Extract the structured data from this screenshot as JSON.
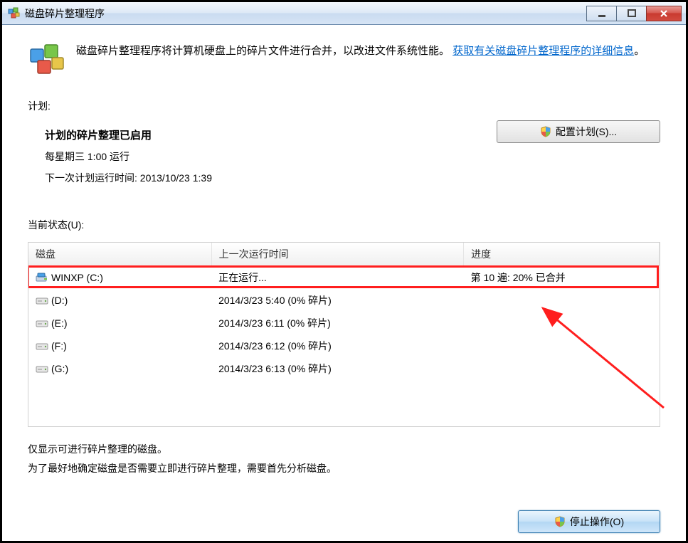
{
  "window": {
    "title": "磁盘碎片整理程序"
  },
  "intro": {
    "text_before_link": "磁盘碎片整理程序将计算机硬盘上的碎片文件进行合并，以改进文件系统性能。",
    "link_text": "获取有关磁盘碎片整理程序的详细信息",
    "period": "。"
  },
  "schedule": {
    "label": "计划:",
    "title": "计划的碎片整理已启用",
    "when": "每星期三   1:00 运行",
    "next": "下一次计划运行时间: 2013/10/23 1:39",
    "config_button": "配置计划(S)..."
  },
  "status": {
    "label": "当前状态(U):"
  },
  "table": {
    "col_disk": "磁盘",
    "col_last": "上一次运行时间",
    "col_progress": "进度",
    "rows": [
      {
        "icon": "os",
        "name": "WINXP (C:)",
        "last": "正在运行...",
        "progress": "第 10 遍: 20% 已合并"
      },
      {
        "icon": "hdd",
        "name": "(D:)",
        "last": "2014/3/23 5:40 (0% 碎片)",
        "progress": ""
      },
      {
        "icon": "hdd",
        "name": "(E:)",
        "last": "2014/3/23 6:11 (0% 碎片)",
        "progress": ""
      },
      {
        "icon": "hdd",
        "name": "(F:)",
        "last": "2014/3/23 6:12 (0% 碎片)",
        "progress": ""
      },
      {
        "icon": "hdd",
        "name": "(G:)",
        "last": "2014/3/23 6:13 (0% 碎片)",
        "progress": ""
      }
    ]
  },
  "notes": {
    "line1": "仅显示可进行碎片整理的磁盘。",
    "line2": "为了最好地确定磁盘是否需要立即进行碎片整理，需要首先分析磁盘。"
  },
  "buttons": {
    "stop": "停止操作(O)"
  }
}
